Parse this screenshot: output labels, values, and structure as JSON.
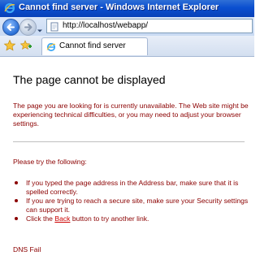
{
  "window": {
    "title": "Cannot find server - Windows Internet Explorer"
  },
  "addressbar": {
    "url": "http://localhost/webapp/"
  },
  "tab": {
    "label": "Cannot find server"
  },
  "content": {
    "heading": "The page cannot be displayed",
    "description": "The page you are looking for is currently unavailable. The Web site might be experiencing technical difficulties, or you may need to adjust your browser settings.",
    "try_label": "Please try the following:",
    "suggestions": [
      "If you typed the page address in the Address bar, make sure that it is spelled correctly.",
      "If you are trying to reach a secure site, make sure your Security settings can support it."
    ],
    "click_prefix": "Click the ",
    "back_link": "Back",
    "click_suffix": " button to try another link.",
    "error_type": "DNS Fail"
  },
  "icons": {
    "app": "ie-logo-icon",
    "back": "back-arrow-icon",
    "forward": "forward-arrow-icon",
    "page": "page-icon",
    "favorites": "favorites-star-icon",
    "add_favorites": "add-favorites-icon"
  },
  "colors": {
    "titlebar": "#0a4fd0",
    "error_text": "#8b0000",
    "link": "#cc0000"
  }
}
